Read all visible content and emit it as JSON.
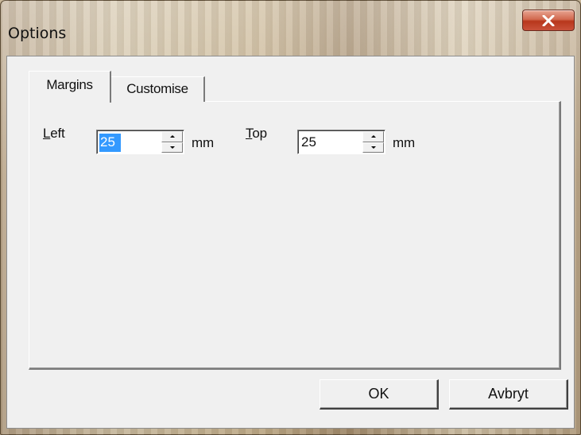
{
  "window": {
    "title": "Options",
    "close_glyph": "X"
  },
  "tabs": [
    {
      "label": "Margins",
      "selected": true
    },
    {
      "label": "Customise",
      "selected": false
    }
  ],
  "margins": {
    "left": {
      "mnemonic": "L",
      "label_rest": "eft",
      "value": "25",
      "unit": "mm",
      "value_selected": true
    },
    "top": {
      "mnemonic": "T",
      "label_rest": "op",
      "value": "25",
      "unit": "mm",
      "value_selected": false
    }
  },
  "buttons": {
    "ok_label": "OK",
    "cancel_label": "Avbryt"
  },
  "colors": {
    "selection": "#3399ff",
    "close_red": "#c9513a",
    "dialog_bg": "#f0f0f0"
  },
  "icons": {
    "close": "close-icon",
    "spin_up": "chevron-up-icon",
    "spin_down": "chevron-down-icon"
  }
}
